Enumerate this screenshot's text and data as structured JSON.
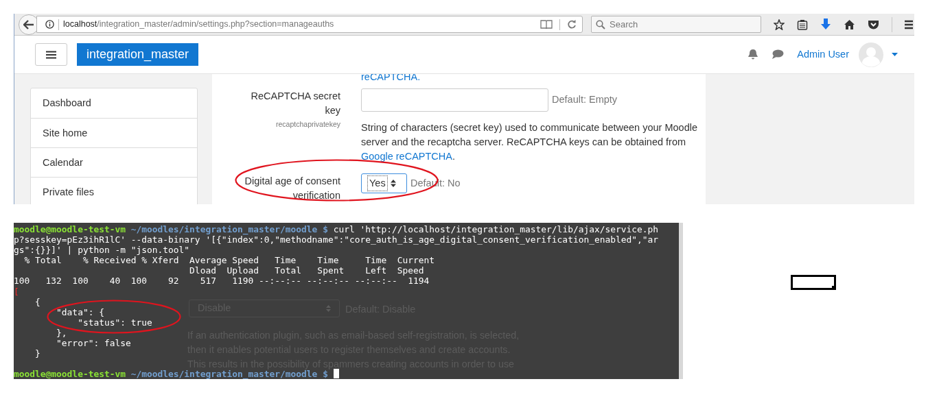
{
  "browser": {
    "url_host": "localhost",
    "url_path": "/integration_master/admin/settings.php?section=manageauths",
    "search_placeholder": "Search"
  },
  "navbar": {
    "brand": "integration_master",
    "user_name": "Admin User"
  },
  "sidebar": {
    "items": [
      {
        "label": "Dashboard"
      },
      {
        "label": "Site home"
      },
      {
        "label": "Calendar"
      },
      {
        "label": "Private files"
      }
    ]
  },
  "settings": {
    "top_link": "reCAPTCHA.",
    "rows": [
      {
        "kind": "text",
        "label": "ReCAPTCHA secret key",
        "setting_name": "recaptchaprivatekey",
        "default": "Default: Empty",
        "description": "String of characters (secret key) used to communicate between your Moodle server and the recaptcha server. ReCAPTCHA keys can be obtained from ",
        "description_link": "Google reCAPTCHA",
        "description_end": ".",
        "circled": false
      },
      {
        "kind": "select",
        "label": "Digital age of consent verification",
        "value": "Yes",
        "default": "Default: No",
        "circled": true
      }
    ]
  },
  "background_page": {
    "select_value": "Disable",
    "default": "Default: Disable",
    "description": "If an authentication plugin, such as email-based self-registration, is selected, then it enables potential users to register themselves and create accounts. This results in the possibility of spammers creating accounts in order to use"
  },
  "terminal": {
    "lines": [
      {
        "kind": "prompt",
        "user": "moodle@moodle-test-vm",
        "path": " ~/moodles/integration_master/moodle $",
        "text": " curl 'http://localhost/integration_master/lib/ajax/service.ph",
        "circled": false
      },
      {
        "kind": "output",
        "text": "p?sesskey=pEz3ihR1lC' --data-binary '[{\"index\":0,\"methodname\":\"core_auth_is_age_digital_consent_verification_enabled\",\"ar",
        "circled": false
      },
      {
        "kind": "output",
        "text": "gs\":{}}]' | python -m \"json.tool\"",
        "circled": false
      },
      {
        "kind": "output",
        "text": "  % Total    % Received % Xferd  Average Speed   Time    Time     Time  Current",
        "circled": false
      },
      {
        "kind": "output",
        "text": "                                 Dload  Upload   Total   Spent    Left  Speed",
        "circled": false
      },
      {
        "kind": "output",
        "text": "100   132  100    40  100    92    517   1190 --:--:-- --:--:-- --:--:--  1194",
        "circled": false
      },
      {
        "kind": "error",
        "text": "[",
        "circled": false
      },
      {
        "kind": "output",
        "text": "    {",
        "circled": false
      },
      {
        "kind": "output",
        "text": "        \"data\": {",
        "circled": true
      },
      {
        "kind": "output",
        "text": "            \"status\": true",
        "circled": true
      },
      {
        "kind": "output",
        "text": "        },",
        "circled": false
      },
      {
        "kind": "output",
        "text": "        \"error\": false",
        "circled": false
      },
      {
        "kind": "output",
        "text": "    }",
        "circled": false
      },
      {
        "kind": "blank",
        "circled": false
      },
      {
        "kind": "prompt",
        "user": "moodle@moodle-test-vm",
        "path": " ~/moodles/integration_master/moodle $",
        "cursor": true,
        "circled": false
      }
    ]
  }
}
